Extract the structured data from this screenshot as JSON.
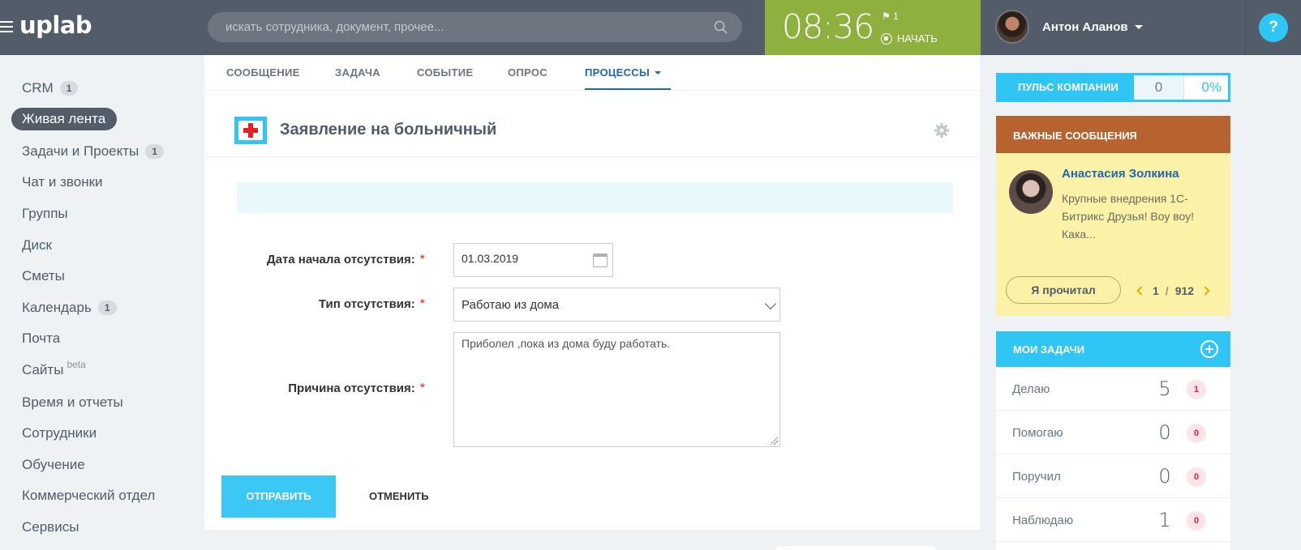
{
  "header": {
    "logo": "uplab",
    "search_placeholder": "искать сотрудника, документ, прочее...",
    "clock": "08:36",
    "flag_count": "1",
    "start_label": "НАЧАТЬ",
    "user_name": "Антон Аланов",
    "help": "?"
  },
  "sidebar": {
    "items": [
      {
        "label": "CRM",
        "counter": "1"
      },
      {
        "label": "Живая лента",
        "counter": ""
      },
      {
        "label": "Задачи и Проекты",
        "counter": "1"
      },
      {
        "label": "Чат и звонки",
        "counter": ""
      },
      {
        "label": "Группы",
        "counter": ""
      },
      {
        "label": "Диск",
        "counter": ""
      },
      {
        "label": "Сметы",
        "counter": ""
      },
      {
        "label": "Календарь",
        "counter": "1"
      },
      {
        "label": "Почта",
        "counter": ""
      },
      {
        "label": "Сайты",
        "counter": "",
        "sup": "beta"
      },
      {
        "label": "Время и отчеты",
        "counter": ""
      },
      {
        "label": "Сотрудники",
        "counter": ""
      },
      {
        "label": "Обучение",
        "counter": ""
      },
      {
        "label": "Коммерческий отдел",
        "counter": ""
      },
      {
        "label": "Сервисы",
        "counter": ""
      }
    ]
  },
  "tabs": [
    "СООБЩЕНИЕ",
    "ЗАДАЧА",
    "СОБЫТИЕ",
    "ОПРОС",
    "ПРОЦЕССЫ"
  ],
  "form": {
    "title": "Заявление на больничный",
    "fields": {
      "start_date": {
        "label": "Дата начала отсутствия:",
        "value": "01.03.2019"
      },
      "type": {
        "label": "Тип отсутствия:",
        "value": "Работаю из дома"
      },
      "reason": {
        "label": "Причина отсутствия:",
        "value": "Приболел ,пока из дома буду работать."
      }
    },
    "required_mark": "*",
    "submit": "ОТПРАВИТЬ",
    "cancel": "ОТМЕНИТЬ"
  },
  "pulse": {
    "label": "ПУЛЬС КОМПАНИИ",
    "value": "0",
    "percent": "0%"
  },
  "important": {
    "title": "ВАЖНЫЕ СООБЩЕНИЯ",
    "author": "Анастасия Золкина",
    "text": "Крупные внедрения 1С-Битрикс Друзья!  Воу воу! Кака...",
    "read_button": "Я прочитал",
    "page_current": "1",
    "page_sep": "/",
    "page_total": "912"
  },
  "tasks": {
    "title": "МОИ ЗАДАЧИ",
    "rows": [
      {
        "label": "Делаю",
        "count": "5",
        "badge": "1"
      },
      {
        "label": "Помогаю",
        "count": "0",
        "badge": "0"
      },
      {
        "label": "Поручил",
        "count": "0",
        "badge": "0"
      },
      {
        "label": "Наблюдаю",
        "count": "1",
        "badge": "0"
      }
    ]
  },
  "colors": {
    "header": "#535c69",
    "timer": "#8db03e",
    "accent": "#2fc6f6",
    "important": "#b66330",
    "important_body": "#fcf2a7",
    "link": "#2067b0"
  }
}
